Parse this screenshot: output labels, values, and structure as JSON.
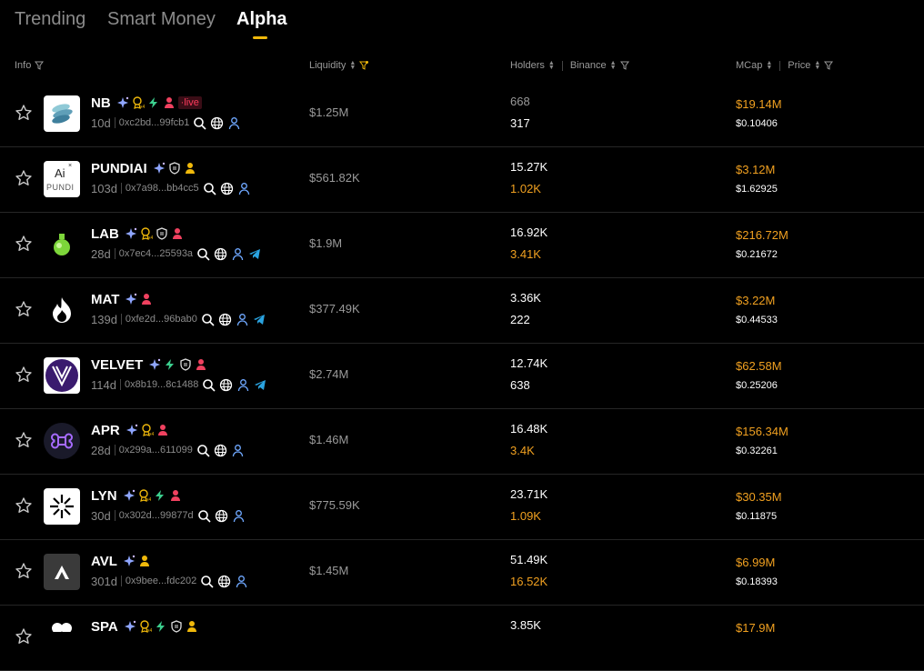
{
  "tabs": [
    {
      "label": "Trending",
      "active": false
    },
    {
      "label": "Smart Money",
      "active": false
    },
    {
      "label": "Alpha",
      "active": true
    }
  ],
  "headers": {
    "info": "Info",
    "liquidity": "Liquidity",
    "holders": "Holders",
    "binance": "Binance",
    "mcap": "MCap",
    "price": "Price"
  },
  "colors": {
    "accent": "#f0b90b",
    "orange": "#f0a020",
    "muted": "#8b8b8b",
    "live": "#ff3b5c"
  },
  "tokens": [
    {
      "name": "NB",
      "age": "10d",
      "address": "0xc2bd...99fcb1",
      "badges": [
        "sparkle-icon",
        "x4-badge-icon",
        "bolt-icon",
        "dev-icon"
      ],
      "live": "live",
      "liquidity": "$1.25M",
      "holders": "668",
      "binance": "317",
      "mcap": "$19.14M",
      "price": "$0.10406",
      "extra_icons": [
        "search-icon",
        "globe-icon",
        "person-icon"
      ],
      "logo": "nb-logo"
    },
    {
      "name": "PUNDIAI",
      "age": "103d",
      "address": "0x7a98...bb4cc5",
      "badges": [
        "sparkle-icon",
        "shield-icon",
        "holder-icon"
      ],
      "liquidity": "$561.82K",
      "holders": "15.27K",
      "binance": "1.02K",
      "mcap": "$3.12M",
      "price": "$1.62925",
      "extra_icons": [
        "search-icon",
        "globe-icon",
        "person-icon"
      ],
      "logo": "pundi-logo",
      "logo_text": "PUNDI",
      "logo_mark": "Ai"
    },
    {
      "name": "LAB",
      "age": "28d",
      "address": "0x7ec4...25593a",
      "badges": [
        "sparkle-icon",
        "x4-badge-icon",
        "shield-icon",
        "dev-icon"
      ],
      "liquidity": "$1.9M",
      "holders": "16.92K",
      "binance": "3.41K",
      "mcap": "$216.72M",
      "price": "$0.21672",
      "extra_icons": [
        "search-icon",
        "globe-icon",
        "person-icon",
        "telegram-icon"
      ],
      "logo": "lab-logo"
    },
    {
      "name": "MAT",
      "age": "139d",
      "address": "0xfe2d...96bab0",
      "badges": [
        "sparkle-icon",
        "dev-icon"
      ],
      "liquidity": "$377.49K",
      "holders": "3.36K",
      "binance": "222",
      "mcap": "$3.22M",
      "price": "$0.44533",
      "extra_icons": [
        "search-icon",
        "globe-icon",
        "person-icon",
        "telegram-icon"
      ],
      "logo": "mat-logo"
    },
    {
      "name": "VELVET",
      "age": "114d",
      "address": "0x8b19...8c1488",
      "badges": [
        "sparkle-icon",
        "bolt-icon",
        "shield-icon",
        "dev-icon"
      ],
      "liquidity": "$2.74M",
      "holders": "12.74K",
      "binance": "638",
      "mcap": "$62.58M",
      "price": "$0.25206",
      "extra_icons": [
        "search-icon",
        "globe-icon",
        "person-icon",
        "telegram-icon"
      ],
      "logo": "velvet-logo"
    },
    {
      "name": "APR",
      "age": "28d",
      "address": "0x299a...611099",
      "badges": [
        "sparkle-icon",
        "x4-badge-icon",
        "dev-icon"
      ],
      "liquidity": "$1.46M",
      "holders": "16.48K",
      "binance": "3.4K",
      "mcap": "$156.34M",
      "price": "$0.32261",
      "extra_icons": [
        "search-icon",
        "globe-icon",
        "person-icon"
      ],
      "logo": "apr-logo"
    },
    {
      "name": "LYN",
      "age": "30d",
      "address": "0x302d...99877d",
      "badges": [
        "sparkle-icon",
        "x4-badge-icon",
        "bolt-icon",
        "dev-icon"
      ],
      "liquidity": "$775.59K",
      "holders": "23.71K",
      "binance": "1.09K",
      "mcap": "$30.35M",
      "price": "$0.11875",
      "extra_icons": [
        "search-icon",
        "globe-icon",
        "person-icon"
      ],
      "logo": "lyn-logo"
    },
    {
      "name": "AVL",
      "age": "301d",
      "address": "0x9bee...fdc202",
      "badges": [
        "sparkle-icon",
        "holder-icon"
      ],
      "liquidity": "$1.45M",
      "holders": "51.49K",
      "binance": "16.52K",
      "mcap": "$6.99M",
      "price": "$0.18393",
      "extra_icons": [
        "search-icon",
        "globe-icon",
        "person-icon"
      ],
      "logo": "avl-logo"
    },
    {
      "name": "SPA",
      "age": "",
      "address": "",
      "badges": [
        "sparkle-icon",
        "x4-badge-icon",
        "bolt-icon",
        "shield-icon",
        "holder-icon"
      ],
      "liquidity": "",
      "holders": "3.85K",
      "binance": "",
      "mcap": "$17.9M",
      "price": "",
      "extra_icons": [],
      "logo": "spa-logo"
    }
  ]
}
